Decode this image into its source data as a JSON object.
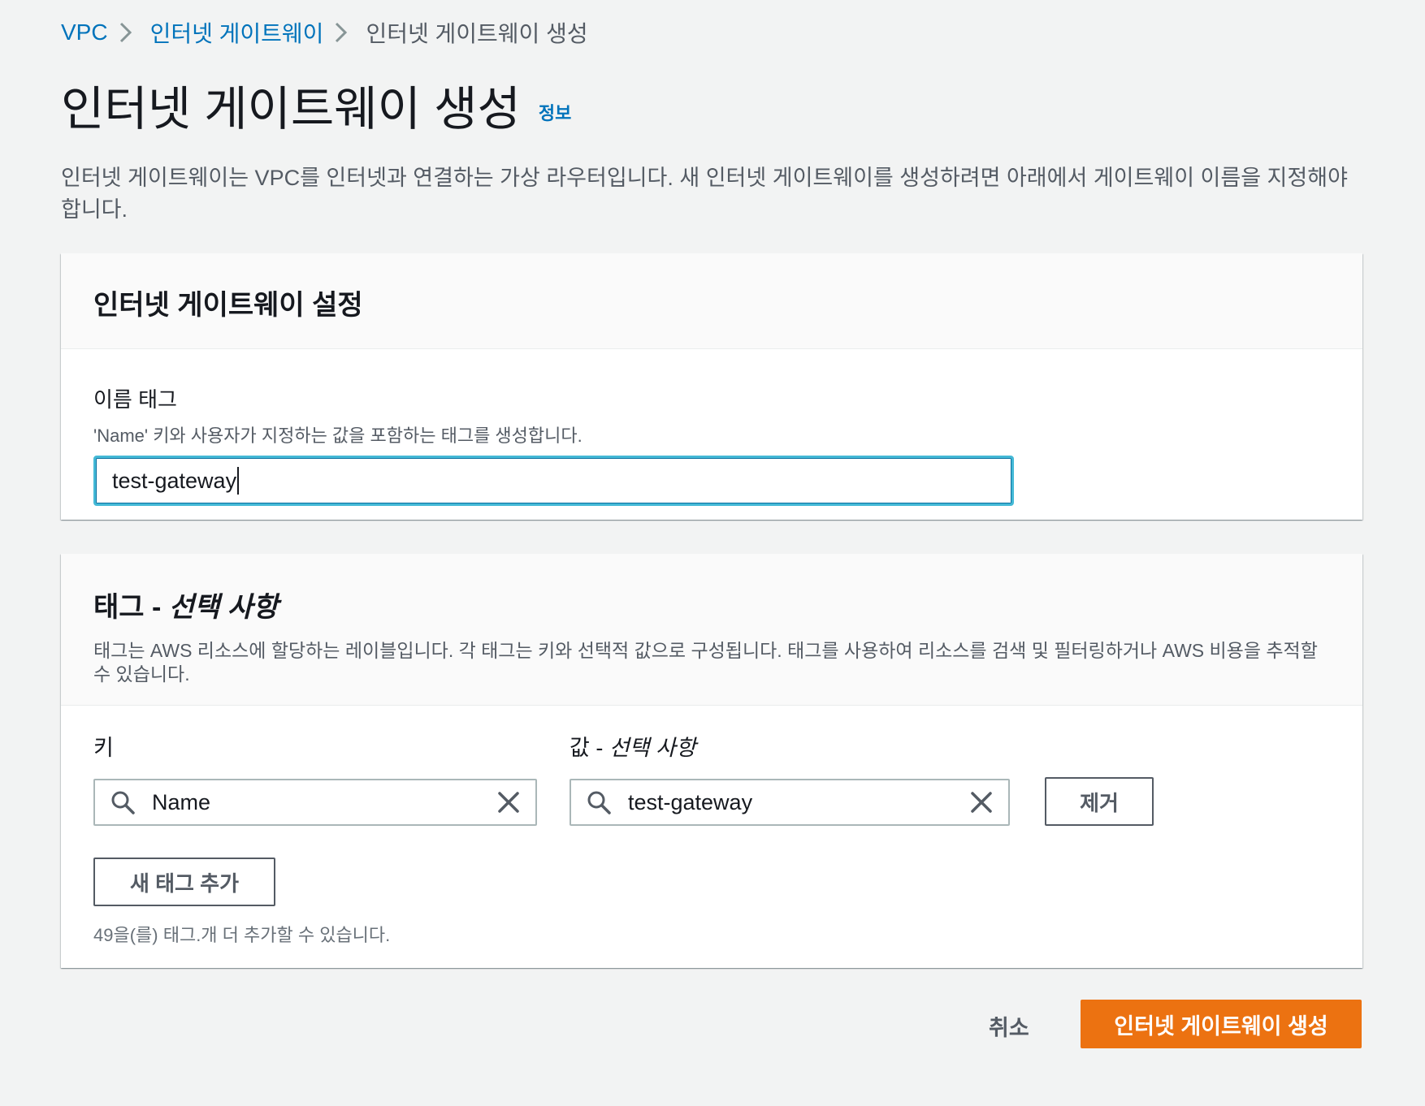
{
  "breadcrumb": {
    "items": [
      "VPC",
      "인터넷 게이트웨이"
    ],
    "current": "인터넷 게이트웨이 생성"
  },
  "header": {
    "title": "인터넷 게이트웨이 생성",
    "info_link": "정보",
    "description": "인터넷 게이트웨이는 VPC를 인터넷과 연결하는 가상 라우터입니다. 새 인터넷 게이트웨이를 생성하려면 아래에서 게이트웨이 이름을 지정해야 합니다."
  },
  "settings_panel": {
    "title": "인터넷 게이트웨이 설정",
    "name_tag_label": "이름 태그",
    "name_tag_description": "'Name' 키와 사용자가 지정하는 값을 포함하는 태그를 생성합니다.",
    "name_tag_value": "test-gateway"
  },
  "tags_panel": {
    "title_main": "태그 - ",
    "title_optional": "선택 사항",
    "description": "태그는 AWS 리소스에 할당하는 레이블입니다. 각 태그는 키와 선택적 값으로 구성됩니다. 태그를 사용하여 리소스를 검색 및 필터링하거나 AWS 비용을 추적할 수 있습니다.",
    "key_label": "키",
    "value_label_main": "값 - ",
    "value_label_optional": "선택 사항",
    "tag_key": "Name",
    "tag_value": "test-gateway",
    "remove_button": "제거",
    "add_tag_button": "새 태그 추가",
    "remaining_text": "49을(를) 태그.개 더 추가할 수 있습니다."
  },
  "footer": {
    "cancel": "취소",
    "submit": "인터넷 게이트웨이 생성"
  },
  "colors": {
    "link": "#0073bb",
    "primary_button": "#ec7211",
    "focus_border": "#44b9d6",
    "background": "#f2f3f3"
  },
  "icons": [
    "chevron-right-icon",
    "search-icon",
    "clear-icon"
  ]
}
